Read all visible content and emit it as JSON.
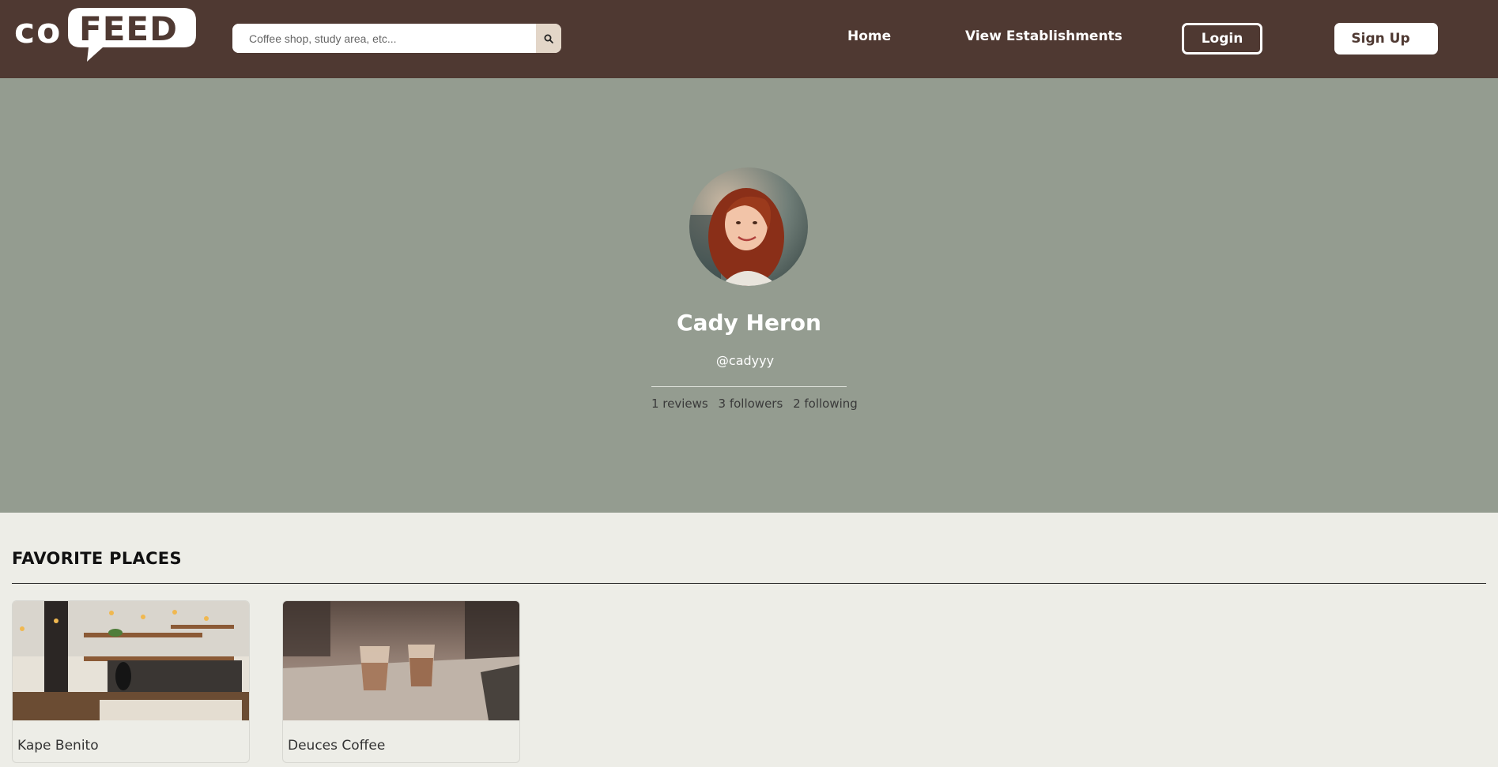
{
  "brand": {
    "logo_left": "co",
    "logo_right": "FEED"
  },
  "search": {
    "placeholder": "Coffee shop, study area, etc...",
    "value": "",
    "icon": "search-icon"
  },
  "nav": {
    "home": "Home",
    "view_establishments": "View Establishments",
    "login": "Login",
    "signup": "Sign Up"
  },
  "profile": {
    "name": "Cady Heron",
    "handle": "@cadyyy",
    "reviews": "1 reviews",
    "followers": "3 followers",
    "following": "2 following"
  },
  "favorites": {
    "title": "FAVORITE PLACES",
    "items": [
      {
        "name": "Kape Benito"
      },
      {
        "name": "Deuces Coffee"
      }
    ]
  },
  "colors": {
    "navbar": "#4f3932",
    "banner": "#949c90",
    "page": "#edede7",
    "search_button": "#e3d6c8"
  }
}
